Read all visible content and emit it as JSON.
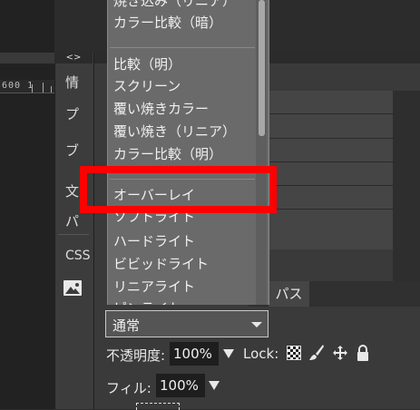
{
  "panel_strip": {
    "toggle": "<>",
    "tabs": [
      "情",
      "プ",
      "ブ",
      "文",
      "パ",
      "CSS"
    ],
    "image_icon": "image-icon"
  },
  "ruler": {
    "text": "600 1"
  },
  "blend_dropdown": {
    "items_top": [
      "焼き込み（リニア）",
      "カラー比較（暗）"
    ],
    "items_lighten": [
      "比較（明）",
      "スクリーン",
      "覆い焼きカラー",
      "覆い焼き（リニア）",
      "カラー比較（明）"
    ],
    "items_contrast": [
      "オーバーレイ",
      "ソフトライト",
      "ハードライト",
      "ビビッドライト",
      "リニアライト",
      "ピンライト"
    ]
  },
  "highlight_color": "#ff0000",
  "blend_mode": {
    "value": "通常"
  },
  "tabs": {
    "chevron": "◀",
    "paths": "パス"
  },
  "opacity": {
    "label": "不透明度:",
    "value": "100%"
  },
  "lock": {
    "label": "Lock:"
  },
  "fill": {
    "label": "フィル:",
    "value": "100%"
  }
}
